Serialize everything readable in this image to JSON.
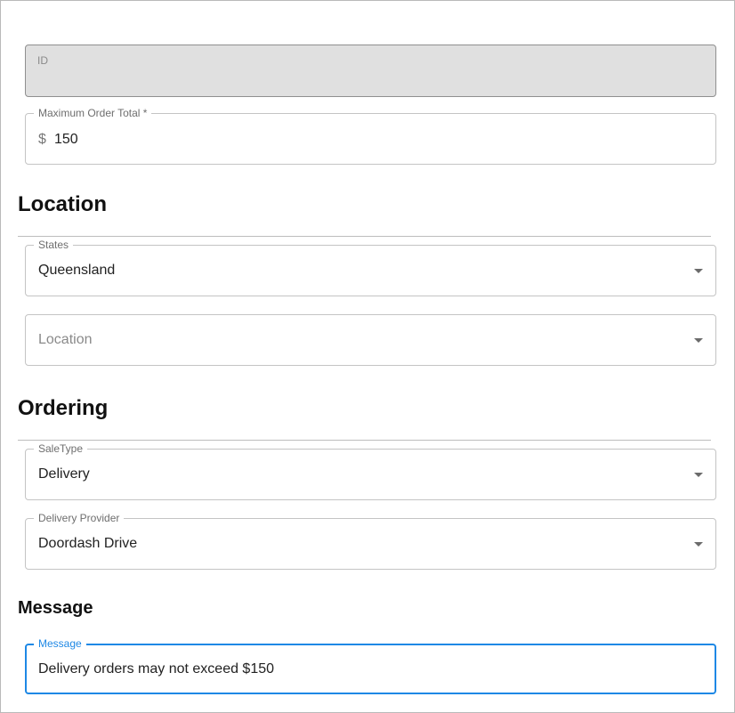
{
  "form": {
    "id_field": {
      "label": "ID",
      "value": ""
    },
    "max_order_total": {
      "label": "Maximum Order Total *",
      "prefix": "$",
      "value": "150"
    }
  },
  "location_section": {
    "heading": "Location",
    "states": {
      "label": "States",
      "value": "Queensland"
    },
    "location": {
      "placeholder": "Location"
    }
  },
  "ordering_section": {
    "heading": "Ordering",
    "sale_type": {
      "label": "SaleType",
      "value": "Delivery"
    },
    "delivery_provider": {
      "label": "Delivery Provider",
      "value": "Doordash Drive"
    }
  },
  "message_section": {
    "heading": "Message",
    "message": {
      "label": "Message",
      "value": "Delivery orders may not exceed $150"
    }
  },
  "icons": {
    "dropdown": "chevron-down-icon",
    "currency": "dollar-sign"
  },
  "colors": {
    "focus_accent": "#1e88e5",
    "disabled_bg": "#e0e0e0",
    "border": "#c4c4c4"
  }
}
